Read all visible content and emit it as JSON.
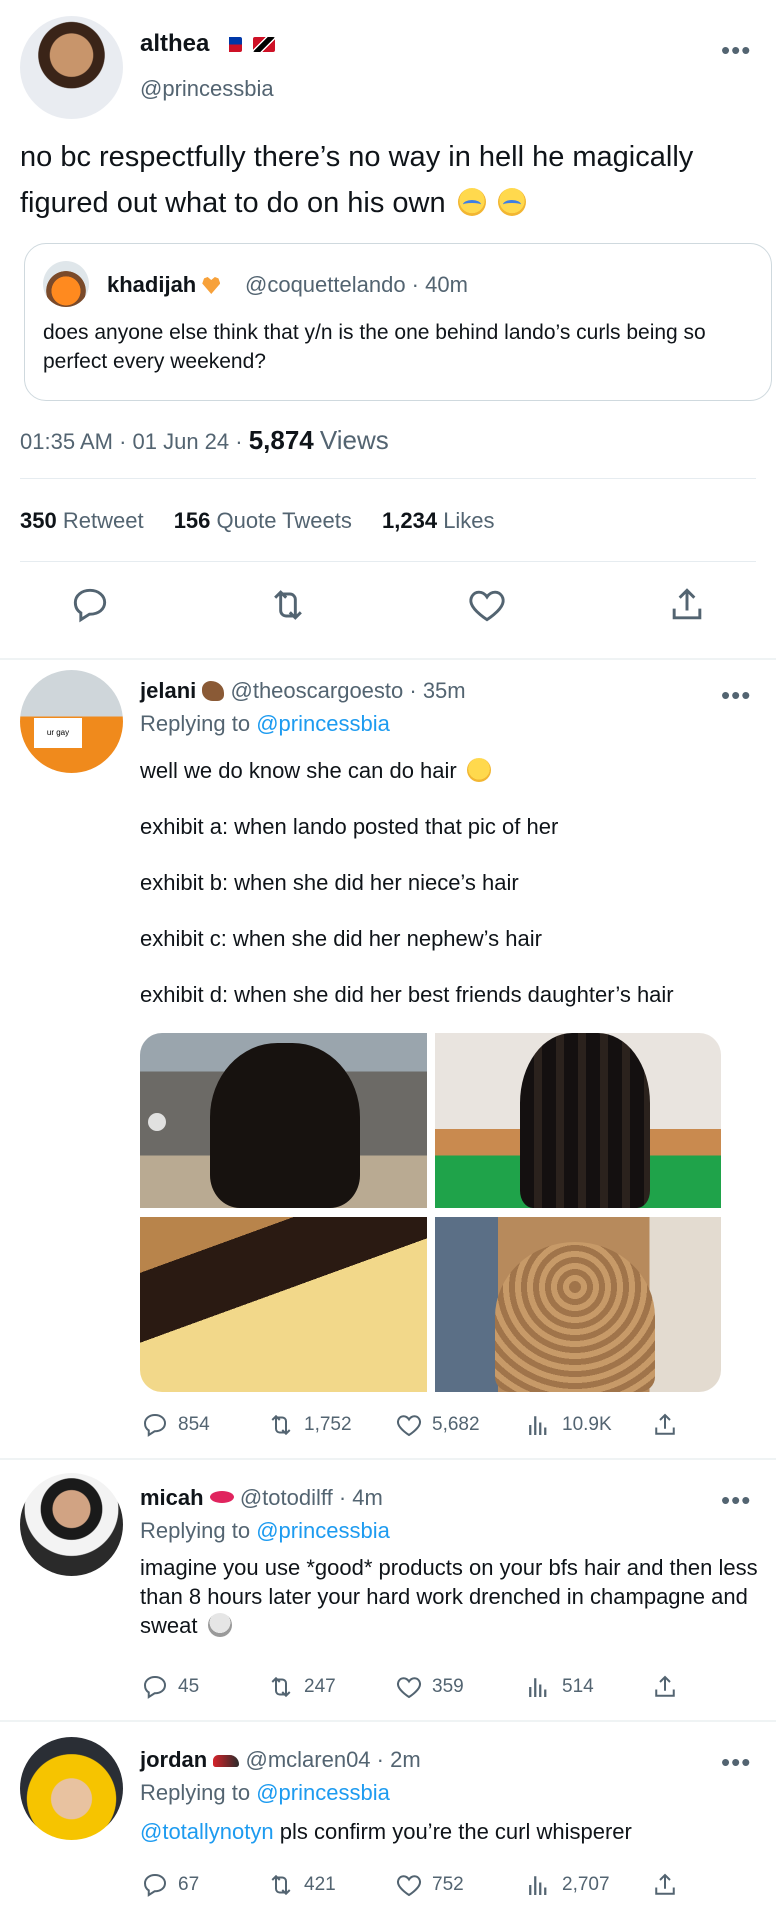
{
  "main_tweet": {
    "name": "althea",
    "handle": "@princessbia",
    "text": "no bc respectfully there’s no way in hell he magically figured out what to do on his own",
    "quote": {
      "name": "khadijah",
      "handle_time": "@coquettelando · 40m",
      "text": "does anyone else think that y/n is the one behind lando’s curls being so perfect every weekend?"
    },
    "timestamp": "01:35 AM · 01 Jun 24 · ",
    "views_count": "5,874",
    "views_label": "Views",
    "retweets": "350",
    "retweets_label": "Retweet",
    "quotes": "156",
    "quotes_label": "Quote Tweets",
    "likes": "1,234",
    "likes_label": "Likes"
  },
  "replies": [
    {
      "name": "jelani",
      "handle_time": "@theoscargoesto · 35m",
      "replying_label": "Replying to",
      "replying_handle": "@princessbia",
      "paragraphs": [
        "well we do know she can do hair",
        "exhibit a: when lando posted that pic of her",
        "exhibit b: when she did her niece’s hair",
        "exhibit c: when she did her nephew’s hair",
        "exhibit d: when she did her best friends daughter’s hair"
      ],
      "avatar_sign": "ur gay",
      "comments": "854",
      "retweets": "1,752",
      "likes": "5,682",
      "views": "10.9K"
    },
    {
      "name": "micah",
      "handle_time": "@totodilff · 4m",
      "replying_label": "Replying to",
      "replying_handle": "@princessbia",
      "text": "imagine you use *good* products on your bfs hair and then less than 8 hours later your hard work drenched in champagne and sweat",
      "comments": "45",
      "retweets": "247",
      "likes": "359",
      "views": "514"
    },
    {
      "name": "jordan",
      "handle_time": "@mclaren04 · 2m",
      "replying_label": "Replying to",
      "replying_handle": "@princessbia",
      "mention": "@totallynotyn",
      "text": " pls confirm you’re the curl whisperer",
      "comments": "67",
      "retweets": "421",
      "likes": "752",
      "views": "2,707"
    }
  ],
  "colors": {
    "accent": "#1d9bf0",
    "secondary_text": "#536471",
    "divider": "#eff3f4"
  },
  "icons": [
    "reply-icon",
    "retweet-icon",
    "like-icon",
    "views-icon",
    "share-icon",
    "more-icon"
  ]
}
